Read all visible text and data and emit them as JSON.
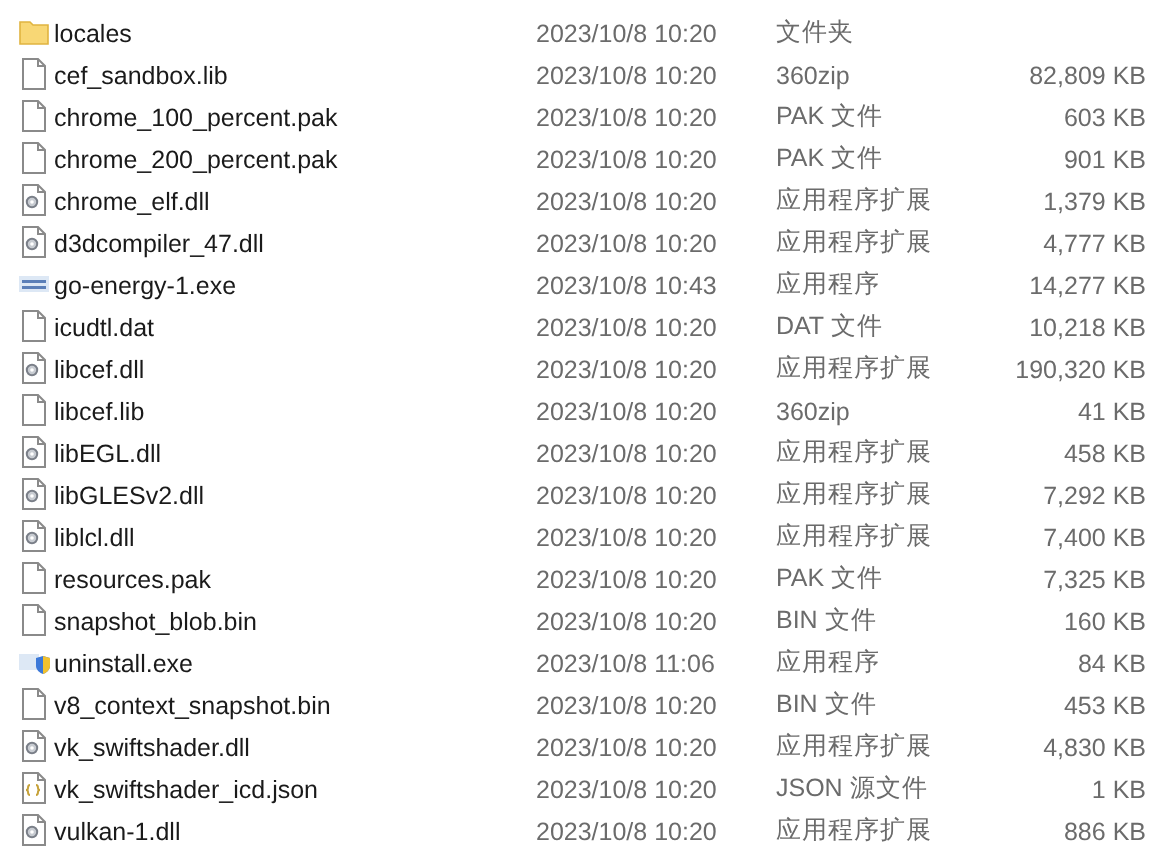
{
  "files": [
    {
      "name": "locales",
      "modified": "2023/10/8 10:20",
      "type": "文件夹",
      "kind": "folder"
    },
    {
      "name": "cef_sandbox.lib",
      "modified": "2023/10/8 10:20",
      "type": "360zip",
      "size": "82,809 KB",
      "kind": "file"
    },
    {
      "name": "chrome_100_percent.pak",
      "modified": "2023/10/8 10:20",
      "type": "PAK 文件",
      "size": "603 KB",
      "kind": "file"
    },
    {
      "name": "chrome_200_percent.pak",
      "modified": "2023/10/8 10:20",
      "type": "PAK 文件",
      "size": "901 KB",
      "kind": "file"
    },
    {
      "name": "chrome_elf.dll",
      "modified": "2023/10/8 10:20",
      "type": "应用程序扩展",
      "size": "1,379 KB",
      "kind": "dll"
    },
    {
      "name": "d3dcompiler_47.dll",
      "modified": "2023/10/8 10:20",
      "type": "应用程序扩展",
      "size": "4,777 KB",
      "kind": "dll"
    },
    {
      "name": "go-energy-1.exe",
      "modified": "2023/10/8 10:43",
      "type": "应用程序",
      "size": "14,277 KB",
      "kind": "app"
    },
    {
      "name": "icudtl.dat",
      "modified": "2023/10/8 10:20",
      "type": "DAT 文件",
      "size": "10,218 KB",
      "kind": "file"
    },
    {
      "name": "libcef.dll",
      "modified": "2023/10/8 10:20",
      "type": "应用程序扩展",
      "size": "190,320 KB",
      "kind": "dll"
    },
    {
      "name": "libcef.lib",
      "modified": "2023/10/8 10:20",
      "type": "360zip",
      "size": "41 KB",
      "kind": "file"
    },
    {
      "name": "libEGL.dll",
      "modified": "2023/10/8 10:20",
      "type": "应用程序扩展",
      "size": "458 KB",
      "kind": "dll"
    },
    {
      "name": "libGLESv2.dll",
      "modified": "2023/10/8 10:20",
      "type": "应用程序扩展",
      "size": "7,292 KB",
      "kind": "dll"
    },
    {
      "name": "liblcl.dll",
      "modified": "2023/10/8 10:20",
      "type": "应用程序扩展",
      "size": "7,400 KB",
      "kind": "dll"
    },
    {
      "name": "resources.pak",
      "modified": "2023/10/8 10:20",
      "type": "PAK 文件",
      "size": "7,325 KB",
      "kind": "file"
    },
    {
      "name": "snapshot_blob.bin",
      "modified": "2023/10/8 10:20",
      "type": "BIN 文件",
      "size": "160 KB",
      "kind": "file"
    },
    {
      "name": "uninstall.exe",
      "modified": "2023/10/8 11:06",
      "type": "应用程序",
      "size": "84 KB",
      "kind": "installer"
    },
    {
      "name": "v8_context_snapshot.bin",
      "modified": "2023/10/8 10:20",
      "type": "BIN 文件",
      "size": "453 KB",
      "kind": "file"
    },
    {
      "name": "vk_swiftshader.dll",
      "modified": "2023/10/8 10:20",
      "type": "应用程序扩展",
      "size": "4,830 KB",
      "kind": "dll"
    },
    {
      "name": "vk_swiftshader_icd.json",
      "modified": "2023/10/8 10:20",
      "type": "JSON 源文件",
      "size": "1 KB",
      "kind": "json"
    },
    {
      "name": "vulkan-1.dll",
      "modified": "2023/10/8 10:20",
      "type": "应用程序扩展",
      "size": "886 KB",
      "kind": "dll"
    }
  ]
}
